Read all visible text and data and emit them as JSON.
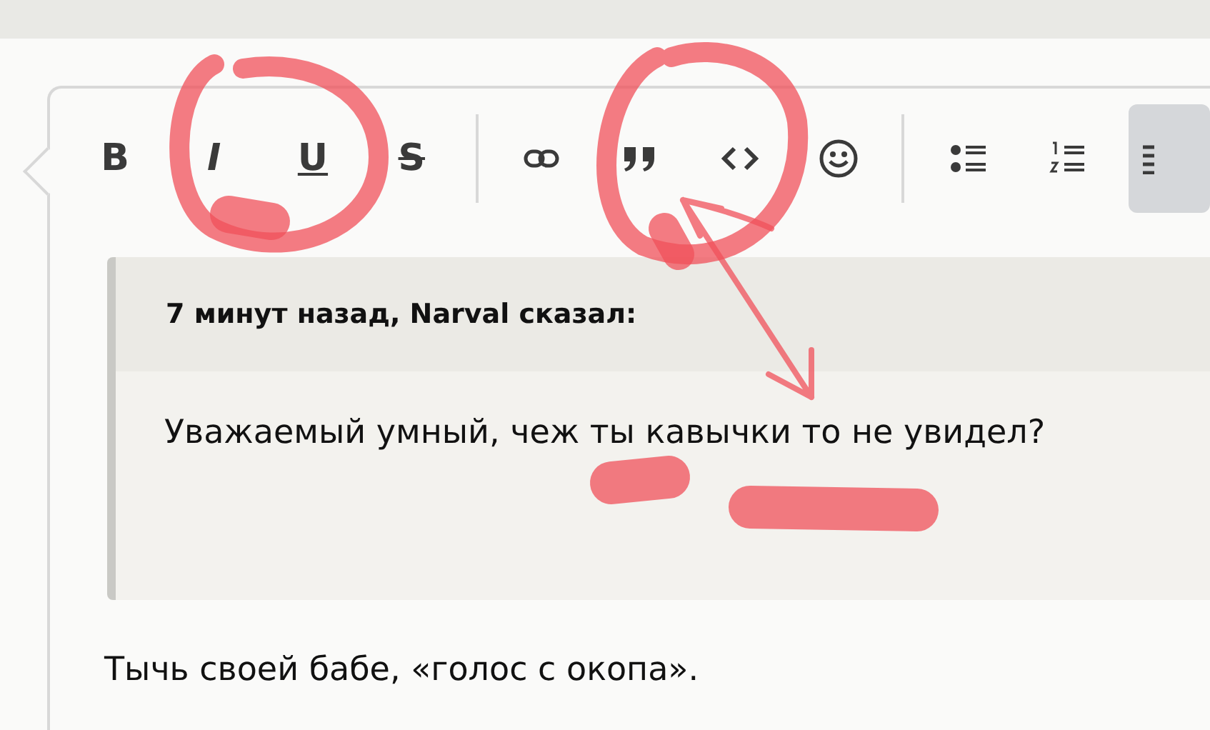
{
  "toolbar": [
    {
      "kind": "bold",
      "label": "B",
      "selected": false
    },
    {
      "kind": "italic",
      "label": "I",
      "selected": false
    },
    {
      "kind": "underline",
      "label": "U",
      "selected": false
    },
    {
      "kind": "strike",
      "label": "S",
      "selected": false
    },
    {
      "kind": "divider"
    },
    {
      "kind": "link",
      "selected": false
    },
    {
      "kind": "quote",
      "selected": false
    },
    {
      "kind": "code",
      "selected": false
    },
    {
      "kind": "emoji",
      "selected": false
    },
    {
      "kind": "divider"
    },
    {
      "kind": "bullets",
      "selected": false
    },
    {
      "kind": "numbers",
      "selected": false
    },
    {
      "kind": "align",
      "selected": true
    }
  ],
  "quote": {
    "header": "7 минут назад, Narval сказал:",
    "text": "Уважаемый умный, чеж ты кавычки то не увидел?"
  },
  "body": "Тычь своей бабе, «голос с окопа»."
}
